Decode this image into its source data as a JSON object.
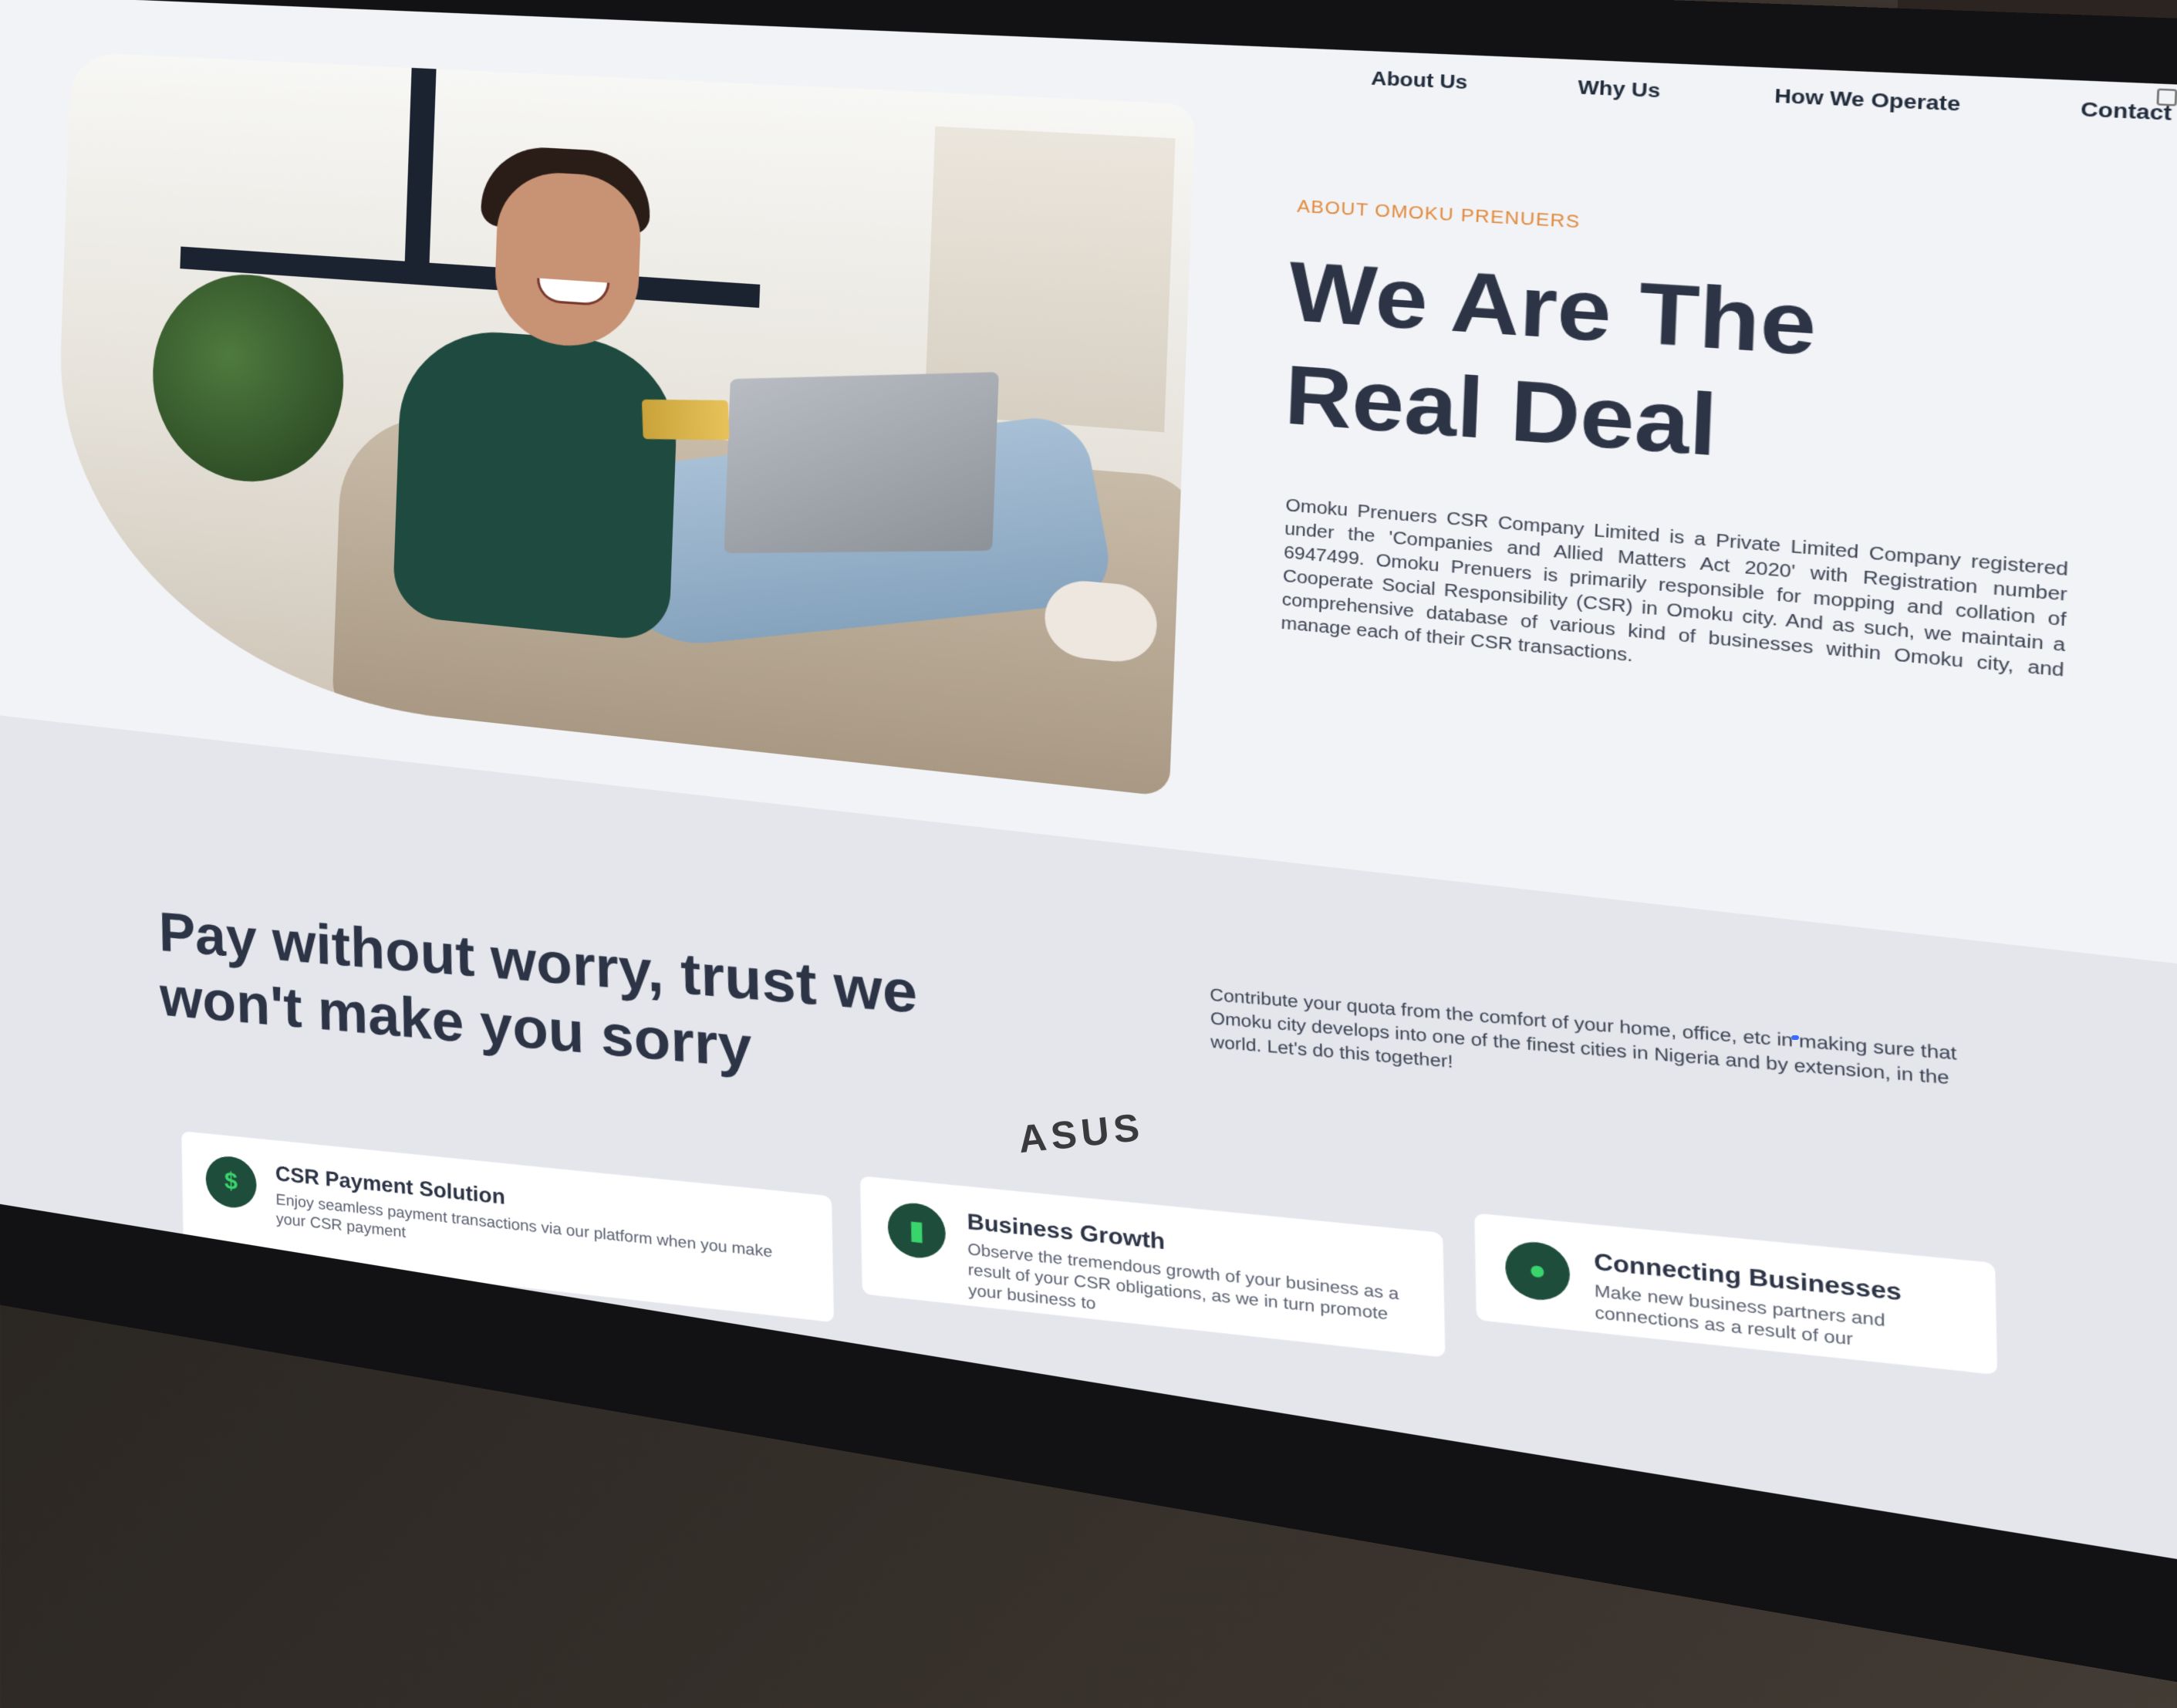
{
  "nav": {
    "items": [
      {
        "label": "About Us"
      },
      {
        "label": "Why Us"
      },
      {
        "label": "How We Operate"
      },
      {
        "label": "Contact Us"
      }
    ]
  },
  "about": {
    "eyebrow": "ABOUT OMOKU PRENUERS",
    "title": "We Are The Real Deal",
    "description": "Omoku Prenuers CSR Company Limited is a Private Limited Company registered under the 'Companies and Allied Matters Act 2020' with Registration number 6947499. Omoku Prenuers is primarily responsible for mopping and collation of Cooperate Social Responsibility (CSR) in Omoku city. And as such, we maintain a comprehensive database of various kind of businesses within Omoku city, and manage each of their CSR transactions."
  },
  "pay": {
    "title": "Pay without worry, trust we won't make you sorry",
    "text": "Contribute your quota from the comfort of your home, office, etc in making sure that Omoku city develops into one of the finest cities in Nigeria and by extension, in the world. Let's do this together!"
  },
  "features": [
    {
      "title": "CSR Payment Solution",
      "text": "Enjoy seamless payment transactions via our platform when you make your CSR payment",
      "icon": "dollar-icon"
    },
    {
      "title": "Business Growth",
      "text": "Observe the tremendous growth of your business as a result of your CSR obligations, as we in turn promote your business to",
      "icon": "chart-icon"
    },
    {
      "title": "Connecting Businesses",
      "text": "Make new business partners and connections as a result of our",
      "icon": "people-icon"
    }
  ],
  "monitor_brand": "ASUS",
  "colors": {
    "accent": "#e08a3c",
    "heading": "#2c3446",
    "icon_bg": "#1f4d3b",
    "icon_fg": "#39d46b"
  }
}
